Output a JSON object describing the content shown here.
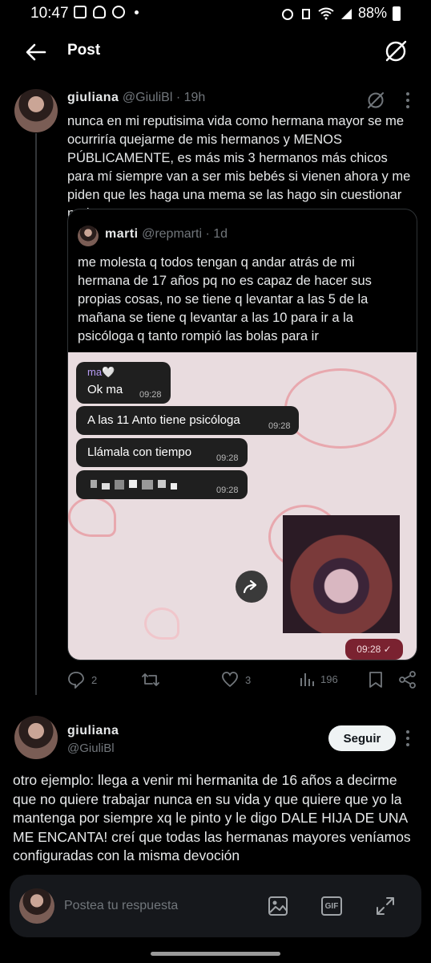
{
  "status": {
    "time": "10:47",
    "battery": "88%"
  },
  "header": {
    "title": "Post"
  },
  "post": {
    "author": "giuliana",
    "handle": "@GiuliBl",
    "time": "· 19h",
    "text": "nunca en mi reputisima vida como hermana mayor se me ocurriría quejarme de mis hermanos y MENOS PÚBLICAMENTE, es más mis 3 hermanos más chicos para mí siempre van a ser mis bebés si vienen ahora y me piden que les haga una mema se las hago sin cuestionar nada",
    "quote": {
      "author": "marti",
      "handle": "@repmarti",
      "time": "· 1d",
      "text": "me molesta q todos tengan q andar atrás de mi hermana de 17 años pq no es capaz de hacer sus propias cosas, no se tiene q levantar a las 5 de la mañana se tiene q levantar a las 10 para ir a la psicóloga q tanto rompió las bolas para ir",
      "chat": {
        "sender": "ma🤍",
        "messages": [
          {
            "text": "Ok ma",
            "time": "09:28"
          },
          {
            "text": "A las 11 Anto tiene psicóloga",
            "time": "09:28"
          },
          {
            "text": "Llámala con tiempo",
            "time": "09:28"
          },
          {
            "text": "",
            "time": "09:28"
          }
        ],
        "sent_time": "09:28 ✓"
      }
    },
    "stats": {
      "replies": "2",
      "reposts": "",
      "likes": "3",
      "views": "196"
    }
  },
  "reply": {
    "author": "giuliana",
    "handle": "@GiuliBl",
    "follow_label": "Seguir",
    "text": "otro ejemplo: llega a venir mi hermanita de 16 años a decirme que no quiere trabajar nunca en su vida y que quiere que yo la mantenga por siempre xq le pinto y le digo DALE HIJA DE UNA ME ENCANTA! creí que todas las hermanas mayores veníamos configuradas con la misma devoción"
  },
  "composer": {
    "placeholder": "Postea tu respuesta",
    "gif_label": "GIF"
  },
  "icons": [
    "back-arrow-icon",
    "grok-icon",
    "more-icon",
    "reply-icon",
    "repost-icon",
    "like-icon",
    "views-icon",
    "bookmark-icon",
    "share-icon",
    "image-icon",
    "gif-icon",
    "expand-icon"
  ]
}
